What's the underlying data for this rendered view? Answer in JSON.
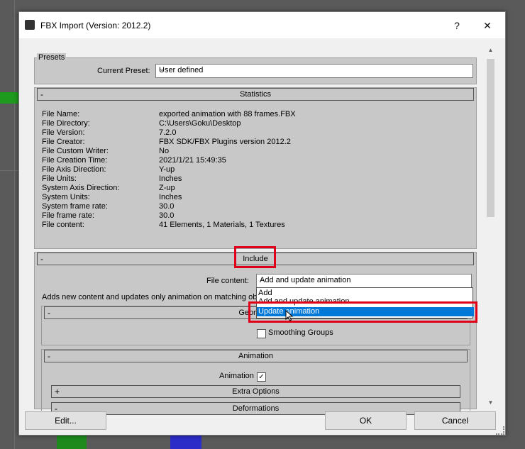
{
  "window": {
    "title": "FBX Import (Version: 2012.2)",
    "help_label": "?",
    "close_label": "✕"
  },
  "presets": {
    "group_label": "Presets",
    "current_label": "Current Preset:",
    "current_value": "User defined"
  },
  "statistics": {
    "header": "Statistics",
    "rows": [
      {
        "label": "File Name:",
        "value": "exported animation with 88 frames.FBX"
      },
      {
        "label": "File Directory:",
        "value": "C:\\Users\\Goku\\Desktop"
      },
      {
        "label": "File Version:",
        "value": "7.2.0"
      },
      {
        "label": "File Creator:",
        "value": "FBX SDK/FBX Plugins version 2012.2"
      },
      {
        "label": "File Custom Writer:",
        "value": "No"
      },
      {
        "label": "File Creation Time:",
        "value": "2021/1/21  15:49:35"
      },
      {
        "label": "File Axis Direction:",
        "value": "Y-up"
      },
      {
        "label": "File Units:",
        "value": "Inches"
      },
      {
        "label": "System Axis Direction:",
        "value": "Z-up"
      },
      {
        "label": "System Units:",
        "value": "Inches"
      },
      {
        "label": "System frame rate:",
        "value": "30.0"
      },
      {
        "label": "File frame rate:",
        "value": "30.0"
      },
      {
        "label": "File content:",
        "value": "41 Elements,    1 Materials,    1 Textures"
      }
    ]
  },
  "include": {
    "header": "Include",
    "file_content_label": "File content:",
    "file_content_value": "Add and update animation",
    "description": "Adds new content and updates only animation on matching obj",
    "options": [
      "Add",
      "Add and update animation",
      "Update animation"
    ],
    "selected_option": "Update animation",
    "geometry_header": "Geometry",
    "smoothing_groups_label": "Smoothing Groups",
    "smoothing_groups_checked": false,
    "animation_header": "Animation",
    "animation_label": "Animation",
    "animation_checked": true,
    "animation_check_glyph": "✓",
    "extra_options_header": "Extra Options",
    "deformations_header": "Deformations"
  },
  "collapse_glyphs": {
    "minus": "-",
    "plus": "+"
  },
  "footer": {
    "edit_label": "Edit...",
    "ok_label": "OK",
    "cancel_label": "Cancel"
  },
  "colors": {
    "highlight_red": "#e0001a",
    "selection_blue": "#0078d7"
  }
}
